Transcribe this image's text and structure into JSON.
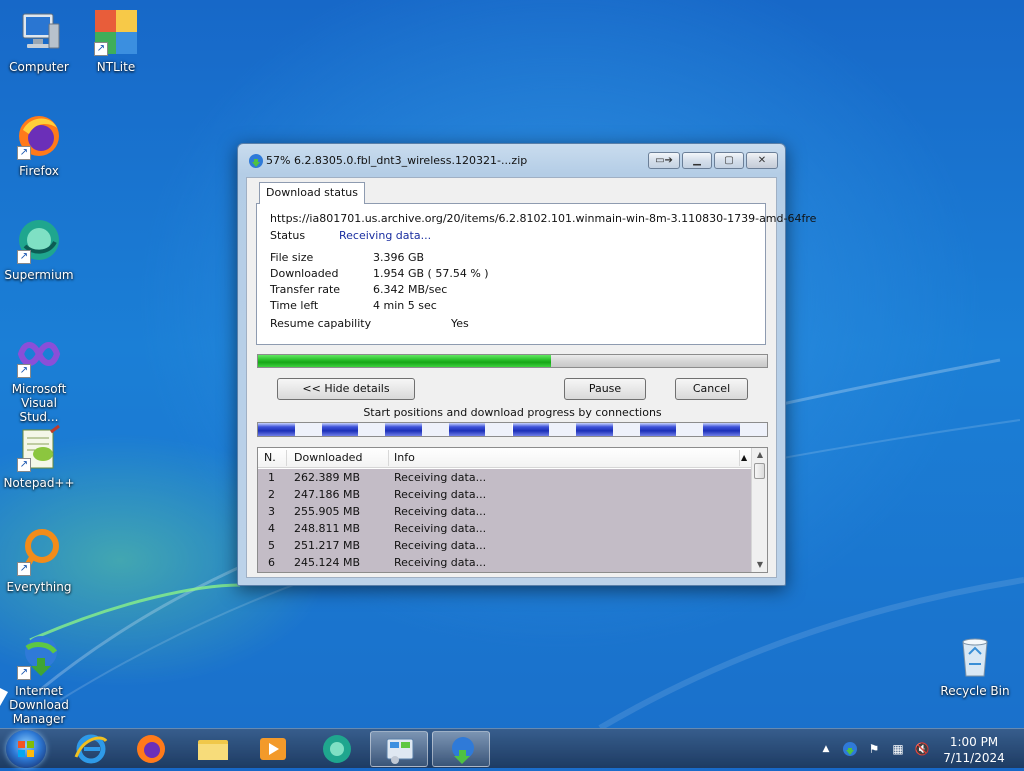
{
  "desktop": {
    "icons": [
      {
        "label": "Computer",
        "icon": "computer-icon"
      },
      {
        "label": "NTLite",
        "icon": "ntlite-icon"
      },
      {
        "label": "Firefox",
        "icon": "firefox-icon"
      },
      {
        "label": "Supermium",
        "icon": "supermium-icon"
      },
      {
        "label": "Microsoft Visual Stud...",
        "icon": "visual-studio-icon"
      },
      {
        "label": "Notepad++",
        "icon": "notepadpp-icon"
      },
      {
        "label": "Everything",
        "icon": "everything-icon"
      },
      {
        "label": "Internet Download Manager",
        "icon": "idm-icon"
      },
      {
        "label": "Recycle Bin",
        "icon": "recycle-bin-icon"
      }
    ]
  },
  "window": {
    "title": "57% 6.2.8305.0.fbl_dnt3_wireless.120321-...zip",
    "tab_label": "Download status",
    "url": "https://ia801701.us.archive.org/20/items/6.2.8102.101.winmain-win-8m-3.110830-1739-amd-64fre",
    "status_label": "Status",
    "status_value": "Receiving data...",
    "fields": [
      {
        "label": "File size",
        "value": "3.396  GB"
      },
      {
        "label": "Downloaded",
        "value": "1.954  GB  ( 57.54 % )"
      },
      {
        "label": "Transfer rate",
        "value": "6.342  MB/sec"
      },
      {
        "label": "Time left",
        "value": "4 min 5 sec"
      }
    ],
    "resume_label": "Resume capability",
    "resume_value": "Yes",
    "progress_percent": 57.54,
    "buttons": {
      "hide_details": "<< Hide details",
      "pause": "Pause",
      "cancel": "Cancel"
    },
    "connections_caption": "Start positions and download progress by connections",
    "table": {
      "columns": [
        "N.",
        "Downloaded",
        "Info"
      ],
      "rows": [
        [
          "1",
          "262.389  MB",
          "Receiving data..."
        ],
        [
          "2",
          "247.186  MB",
          "Receiving data..."
        ],
        [
          "3",
          "255.905  MB",
          "Receiving data..."
        ],
        [
          "4",
          "248.811  MB",
          "Receiving data..."
        ],
        [
          "5",
          "251.217  MB",
          "Receiving data..."
        ],
        [
          "6",
          "245.124  MB",
          "Receiving data..."
        ]
      ]
    }
  },
  "taskbar": {
    "items": [
      "start-orb",
      "internet-explorer-icon",
      "firefox-icon",
      "file-explorer-icon",
      "media-player-icon",
      "supermium-icon",
      "control-panel-icon",
      "idm-icon"
    ],
    "time": "1:00 PM",
    "date": "7/11/2024"
  }
}
